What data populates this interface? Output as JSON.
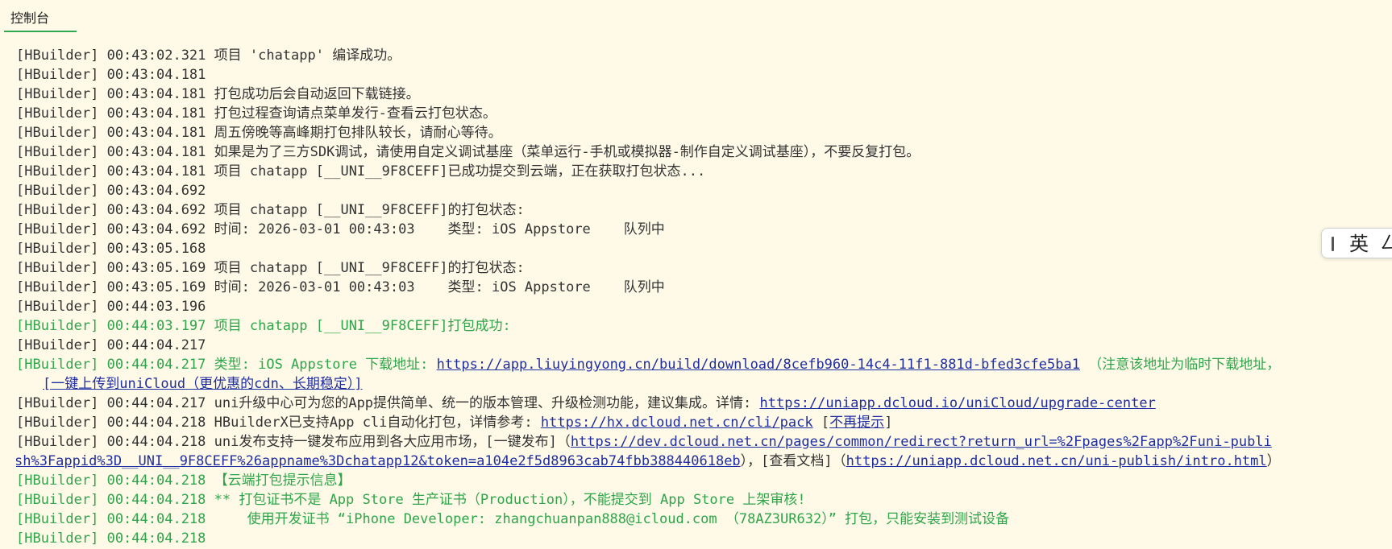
{
  "tab": {
    "label": "控制台"
  },
  "ime": {
    "lang": "英",
    "extra": "ㄥ"
  },
  "console": {
    "lines": [
      {
        "type": "plain",
        "text": "[HBuilder] 00:43:02.321 项目 'chatapp' 编译成功。"
      },
      {
        "type": "plain",
        "text": "[HBuilder] 00:43:04.181"
      },
      {
        "type": "plain",
        "text": "[HBuilder] 00:43:04.181 打包成功后会自动返回下载链接。"
      },
      {
        "type": "plain",
        "text": "[HBuilder] 00:43:04.181 打包过程查询请点菜单发行-查看云打包状态。"
      },
      {
        "type": "plain",
        "text": "[HBuilder] 00:43:04.181 周五傍晚等高峰期打包排队较长，请耐心等待。"
      },
      {
        "type": "plain",
        "text": "[HBuilder] 00:43:04.181 如果是为了三方SDK调试，请使用自定义调试基座（菜单运行-手机或模拟器-制作自定义调试基座），不要反复打包。"
      },
      {
        "type": "plain",
        "text": "[HBuilder] 00:43:04.181 项目 chatapp [__UNI__9F8CEFF]已成功提交到云端，正在获取打包状态..."
      },
      {
        "type": "plain",
        "text": "[HBuilder] 00:43:04.692"
      },
      {
        "type": "plain",
        "text": "[HBuilder] 00:43:04.692 项目 chatapp [__UNI__9F8CEFF]的打包状态:"
      },
      {
        "type": "plain",
        "text": "[HBuilder] 00:43:04.692 时间: 2026-03-01 00:43:03    类型: iOS Appstore    队列中"
      },
      {
        "type": "plain",
        "text": "[HBuilder] 00:43:05.168"
      },
      {
        "type": "plain",
        "text": "[HBuilder] 00:43:05.169 项目 chatapp [__UNI__9F8CEFF]的打包状态:"
      },
      {
        "type": "plain",
        "text": "[HBuilder] 00:43:05.169 时间: 2026-03-01 00:43:03    类型: iOS Appstore    队列中"
      },
      {
        "type": "plain",
        "text": "[HBuilder] 00:44:03.196"
      },
      {
        "type": "green",
        "text": "[HBuilder] 00:44:03.197 项目 chatapp [__UNI__9F8CEFF]打包成功:"
      },
      {
        "type": "plain",
        "text": "[HBuilder] 00:44:04.217"
      },
      {
        "type": "download",
        "prefix": "[HBuilder] 00:44:04.217 类型: iOS Appstore 下载地址: ",
        "url": "https://app.liuyingyong.cn/build/download/8cefb960-14c4-11f1-881d-bfed3cfe5ba1",
        "suffix": " （注意该地址为临时下载地址，"
      },
      {
        "type": "cloud",
        "bracket_open": "[",
        "link": "一键上传到uniCloud（更优惠的cdn、长期稳定）",
        "bracket_close": "]"
      },
      {
        "type": "linkline",
        "prefix": "[HBuilder] 00:44:04.217 uni升级中心可为您的App提供简单、统一的版本管理、升级检测功能，建议集成。详情: ",
        "url": "https://uniapp.dcloud.io/uniCloud/upgrade-center"
      },
      {
        "type": "cli",
        "prefix": "[HBuilder] 00:44:04.218 HBuilderX已支持App cli自动化打包，详情参考: ",
        "url": "https://hx.dcloud.net.cn/cli/pack",
        "mid": " [",
        "link2": "不再提示",
        "end": "]"
      },
      {
        "type": "publish",
        "prefix": "[HBuilder] 00:44:04.218 uni发布支持一键发布应用到各大应用市场，[一键发布]（",
        "url": "https://dev.dcloud.net.cn/pages/common/redirect?return_url=%2Fpages%2Fapp%2Funi-publi"
      },
      {
        "type": "publish2",
        "url": "sh%3Fappid%3D__UNI__9F8CEFF%26appname%3Dchatapp12&token=a104e2f5d8963cab74fbb388440618eb",
        "mid": "），[查看文档]（",
        "url2": "https://uniapp.dcloud.net.cn/uni-publish/intro.html",
        "end": "）"
      },
      {
        "type": "green",
        "text": "[HBuilder] 00:44:04.218 【云端打包提示信息】"
      },
      {
        "type": "green",
        "text": "[HBuilder] 00:44:04.218 ** 打包证书不是 App Store 生产证书（Production），不能提交到 App Store 上架审核!"
      },
      {
        "type": "green",
        "text": "[HBuilder] 00:44:04.218     使用开发证书 “iPhone Developer: zhangchuanpan888@icloud.com （78AZ3UR632）” 打包，只能安装到测试设备"
      },
      {
        "type": "green",
        "text": "[HBuilder] 00:44:04.218"
      }
    ]
  }
}
